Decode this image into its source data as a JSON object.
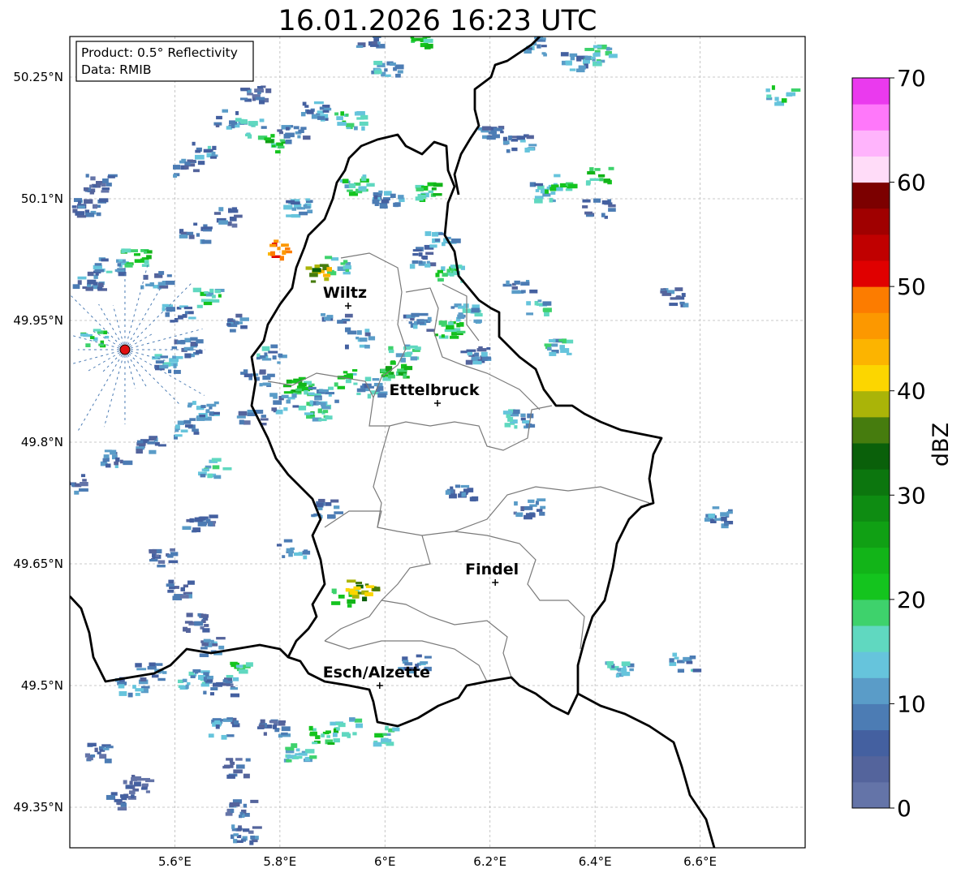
{
  "title": "16.01.2026 16:23 UTC",
  "info_box": {
    "line1": "Product: 0.5° Reflectivity",
    "line2": "Data: RMIB"
  },
  "axes": {
    "lon_range": [
      5.4,
      6.8
    ],
    "lat_range": [
      49.3,
      50.3
    ],
    "lon_ticks": [
      {
        "value": 5.6,
        "label": "5.6°E"
      },
      {
        "value": 5.8,
        "label": "5.8°E"
      },
      {
        "value": 6.0,
        "label": "6°E"
      },
      {
        "value": 6.2,
        "label": "6.2°E"
      },
      {
        "value": 6.4,
        "label": "6.4°E"
      },
      {
        "value": 6.6,
        "label": "6.6°E"
      }
    ],
    "lat_ticks": [
      {
        "value": 50.25,
        "label": "50.25°N"
      },
      {
        "value": 50.1,
        "label": "50.1°N"
      },
      {
        "value": 49.95,
        "label": "49.95°N"
      },
      {
        "value": 49.8,
        "label": "49.8°N"
      },
      {
        "value": 49.65,
        "label": "49.65°N"
      },
      {
        "value": 49.5,
        "label": "49.5°N"
      },
      {
        "value": 49.35,
        "label": "49.35°N"
      }
    ]
  },
  "cities": [
    {
      "name": "Wiltz",
      "lon": 5.93,
      "lat": 49.968
    },
    {
      "name": "Ettelbruck",
      "lon": 6.1,
      "lat": 49.848
    },
    {
      "name": "Findel",
      "lon": 6.21,
      "lat": 49.627
    },
    {
      "name": "Esch/Alzette",
      "lon": 5.99,
      "lat": 49.5
    }
  ],
  "radar_site": {
    "lon": 5.505,
    "lat": 49.914,
    "color": "#e01010"
  },
  "colorbar": {
    "label": "dBZ",
    "min": 0,
    "max": 70,
    "ticks": [
      {
        "value": 0,
        "label": "0"
      },
      {
        "value": 10,
        "label": "10"
      },
      {
        "value": 20,
        "label": "20"
      },
      {
        "value": 30,
        "label": "30"
      },
      {
        "value": 40,
        "label": "40"
      },
      {
        "value": 50,
        "label": "50"
      },
      {
        "value": 60,
        "label": "60"
      },
      {
        "value": 70,
        "label": "70"
      }
    ],
    "colors": [
      "#6474a8",
      "#54649c",
      "#4460a0",
      "#4c7cb4",
      "#5a9cc8",
      "#66c4dc",
      "#60d8c0",
      "#3ed26c",
      "#14c41e",
      "#12b418",
      "#10a014",
      "#0e8c12",
      "#0c760e",
      "#0a600a",
      "#467c0e",
      "#aab408",
      "#fcd600",
      "#fcb400",
      "#fc9800",
      "#fc7c00",
      "#e00000",
      "#c00000",
      "#a00000",
      "#7c0000",
      "#ffdcf8",
      "#ffb4fc",
      "#ff78fa",
      "#ea3aee"
    ]
  },
  "echo_cells": [
    {
      "lon": 5.62,
      "lat": 50.14,
      "dbz": 8
    },
    {
      "lon": 5.65,
      "lat": 50.16,
      "dbz": 12
    },
    {
      "lon": 5.7,
      "lat": 50.2,
      "dbz": 10
    },
    {
      "lon": 5.74,
      "lat": 50.19,
      "dbz": 15
    },
    {
      "lon": 5.78,
      "lat": 50.17,
      "dbz": 22
    },
    {
      "lon": 5.82,
      "lat": 50.18,
      "dbz": 9
    },
    {
      "lon": 5.75,
      "lat": 50.23,
      "dbz": 7
    },
    {
      "lon": 5.86,
      "lat": 50.21,
      "dbz": 11
    },
    {
      "lon": 5.93,
      "lat": 50.2,
      "dbz": 18
    },
    {
      "lon": 5.45,
      "lat": 50.12,
      "dbz": 6
    },
    {
      "lon": 5.43,
      "lat": 50.09,
      "dbz": 8
    },
    {
      "lon": 5.47,
      "lat": 50.02,
      "dbz": 12
    },
    {
      "lon": 5.52,
      "lat": 50.03,
      "dbz": 20
    },
    {
      "lon": 5.56,
      "lat": 50.0,
      "dbz": 9
    },
    {
      "lon": 5.6,
      "lat": 49.96,
      "dbz": 11
    },
    {
      "lon": 5.66,
      "lat": 49.98,
      "dbz": 18
    },
    {
      "lon": 5.72,
      "lat": 49.95,
      "dbz": 8
    },
    {
      "lon": 5.78,
      "lat": 49.91,
      "dbz": 13
    },
    {
      "lon": 5.83,
      "lat": 49.87,
      "dbz": 22
    },
    {
      "lon": 5.86,
      "lat": 49.84,
      "dbz": 17
    },
    {
      "lon": 5.8,
      "lat": 49.85,
      "dbz": 10
    },
    {
      "lon": 5.75,
      "lat": 49.88,
      "dbz": 9
    },
    {
      "lon": 5.88,
      "lat": 49.86,
      "dbz": 14
    },
    {
      "lon": 5.92,
      "lat": 49.88,
      "dbz": 19
    },
    {
      "lon": 5.97,
      "lat": 49.87,
      "dbz": 12
    },
    {
      "lon": 6.01,
      "lat": 49.89,
      "dbz": 23
    },
    {
      "lon": 6.03,
      "lat": 49.91,
      "dbz": 16
    },
    {
      "lon": 5.95,
      "lat": 49.93,
      "dbz": 10
    },
    {
      "lon": 5.9,
      "lat": 49.95,
      "dbz": 8
    },
    {
      "lon": 6.06,
      "lat": 49.95,
      "dbz": 9
    },
    {
      "lon": 6.12,
      "lat": 49.94,
      "dbz": 21
    },
    {
      "lon": 6.15,
      "lat": 49.96,
      "dbz": 14
    },
    {
      "lon": 6.0,
      "lat": 50.1,
      "dbz": 12
    },
    {
      "lon": 6.07,
      "lat": 50.11,
      "dbz": 20
    },
    {
      "lon": 5.94,
      "lat": 50.12,
      "dbz": 18
    },
    {
      "lon": 6.2,
      "lat": 50.18,
      "dbz": 9
    },
    {
      "lon": 6.25,
      "lat": 50.17,
      "dbz": 10
    },
    {
      "lon": 6.3,
      "lat": 50.11,
      "dbz": 13
    },
    {
      "lon": 6.33,
      "lat": 50.12,
      "dbz": 19
    },
    {
      "lon": 6.4,
      "lat": 50.13,
      "dbz": 22
    },
    {
      "lon": 6.4,
      "lat": 50.09,
      "dbz": 8
    },
    {
      "lon": 6.4,
      "lat": 50.28,
      "dbz": 16
    },
    {
      "lon": 6.36,
      "lat": 50.27,
      "dbz": 11
    },
    {
      "lon": 6.28,
      "lat": 50.29,
      "dbz": 12
    },
    {
      "lon": 6.28,
      "lat": 49.97,
      "dbz": 14
    },
    {
      "lon": 6.25,
      "lat": 49.99,
      "dbz": 8
    },
    {
      "lon": 6.32,
      "lat": 49.92,
      "dbz": 15
    },
    {
      "lon": 6.25,
      "lat": 49.83,
      "dbz": 13
    },
    {
      "lon": 6.55,
      "lat": 49.98,
      "dbz": 9
    },
    {
      "lon": 6.75,
      "lat": 50.23,
      "dbz": 18
    },
    {
      "lon": 5.97,
      "lat": 50.3,
      "dbz": 9
    },
    {
      "lon": 6.07,
      "lat": 50.3,
      "dbz": 20
    },
    {
      "lon": 6.0,
      "lat": 50.26,
      "dbz": 12
    },
    {
      "lon": 5.4,
      "lat": 49.75,
      "dbz": 8
    },
    {
      "lon": 5.48,
      "lat": 49.78,
      "dbz": 10
    },
    {
      "lon": 5.55,
      "lat": 49.8,
      "dbz": 9
    },
    {
      "lon": 5.62,
      "lat": 49.82,
      "dbz": 12
    },
    {
      "lon": 5.67,
      "lat": 49.77,
      "dbz": 15
    },
    {
      "lon": 5.57,
      "lat": 49.66,
      "dbz": 6
    },
    {
      "lon": 5.6,
      "lat": 49.62,
      "dbz": 7
    },
    {
      "lon": 5.63,
      "lat": 49.58,
      "dbz": 6
    },
    {
      "lon": 5.66,
      "lat": 49.55,
      "dbz": 9
    },
    {
      "lon": 5.68,
      "lat": 49.5,
      "dbz": 7
    },
    {
      "lon": 5.69,
      "lat": 49.45,
      "dbz": 10
    },
    {
      "lon": 5.71,
      "lat": 49.4,
      "dbz": 6
    },
    {
      "lon": 5.72,
      "lat": 49.35,
      "dbz": 7
    },
    {
      "lon": 5.73,
      "lat": 49.32,
      "dbz": 8
    },
    {
      "lon": 5.52,
      "lat": 49.38,
      "dbz": 5
    },
    {
      "lon": 5.49,
      "lat": 49.36,
      "dbz": 6
    },
    {
      "lon": 5.45,
      "lat": 49.42,
      "dbz": 7
    },
    {
      "lon": 5.51,
      "lat": 49.5,
      "dbz": 12
    },
    {
      "lon": 5.55,
      "lat": 49.52,
      "dbz": 9
    },
    {
      "lon": 5.63,
      "lat": 49.51,
      "dbz": 14
    },
    {
      "lon": 5.72,
      "lat": 49.52,
      "dbz": 18
    },
    {
      "lon": 5.78,
      "lat": 49.45,
      "dbz": 8
    },
    {
      "lon": 5.83,
      "lat": 49.42,
      "dbz": 16
    },
    {
      "lon": 5.88,
      "lat": 49.44,
      "dbz": 21
    },
    {
      "lon": 5.92,
      "lat": 49.45,
      "dbz": 14
    },
    {
      "lon": 6.0,
      "lat": 49.44,
      "dbz": 18
    },
    {
      "lon": 6.05,
      "lat": 49.53,
      "dbz": 11
    },
    {
      "lon": 5.92,
      "lat": 49.61,
      "dbz": 22
    },
    {
      "lon": 5.95,
      "lat": 49.62,
      "dbz": 40
    },
    {
      "lon": 5.82,
      "lat": 49.67,
      "dbz": 12
    },
    {
      "lon": 5.88,
      "lat": 49.72,
      "dbz": 10
    },
    {
      "lon": 5.64,
      "lat": 49.7,
      "dbz": 7
    },
    {
      "lon": 6.14,
      "lat": 49.74,
      "dbz": 9
    },
    {
      "lon": 6.27,
      "lat": 49.72,
      "dbz": 8
    },
    {
      "lon": 6.63,
      "lat": 49.71,
      "dbz": 11
    },
    {
      "lon": 6.44,
      "lat": 49.52,
      "dbz": 14
    },
    {
      "lon": 6.56,
      "lat": 49.53,
      "dbz": 12
    },
    {
      "lon": 5.83,
      "lat": 50.09,
      "dbz": 11
    },
    {
      "lon": 5.9,
      "lat": 50.02,
      "dbz": 16
    },
    {
      "lon": 5.87,
      "lat": 50.01,
      "dbz": 40
    },
    {
      "lon": 5.63,
      "lat": 50.06,
      "dbz": 9
    },
    {
      "lon": 5.7,
      "lat": 50.08,
      "dbz": 7
    },
    {
      "lon": 5.74,
      "lat": 49.83,
      "dbz": 8
    },
    {
      "lon": 5.65,
      "lat": 49.84,
      "dbz": 11
    },
    {
      "lon": 6.1,
      "lat": 50.05,
      "dbz": 12
    },
    {
      "lon": 6.12,
      "lat": 50.01,
      "dbz": 19
    },
    {
      "lon": 6.06,
      "lat": 50.03,
      "dbz": 10
    },
    {
      "lon": 6.17,
      "lat": 49.91,
      "dbz": 9
    },
    {
      "lon": 5.44,
      "lat": 49.93,
      "dbz": 18
    },
    {
      "lon": 5.43,
      "lat": 50.0,
      "dbz": 9
    },
    {
      "lon": 5.58,
      "lat": 49.9,
      "dbz": 12
    },
    {
      "lon": 5.62,
      "lat": 49.92,
      "dbz": 9
    },
    {
      "lon": 5.79,
      "lat": 50.04,
      "dbz": 48
    }
  ]
}
